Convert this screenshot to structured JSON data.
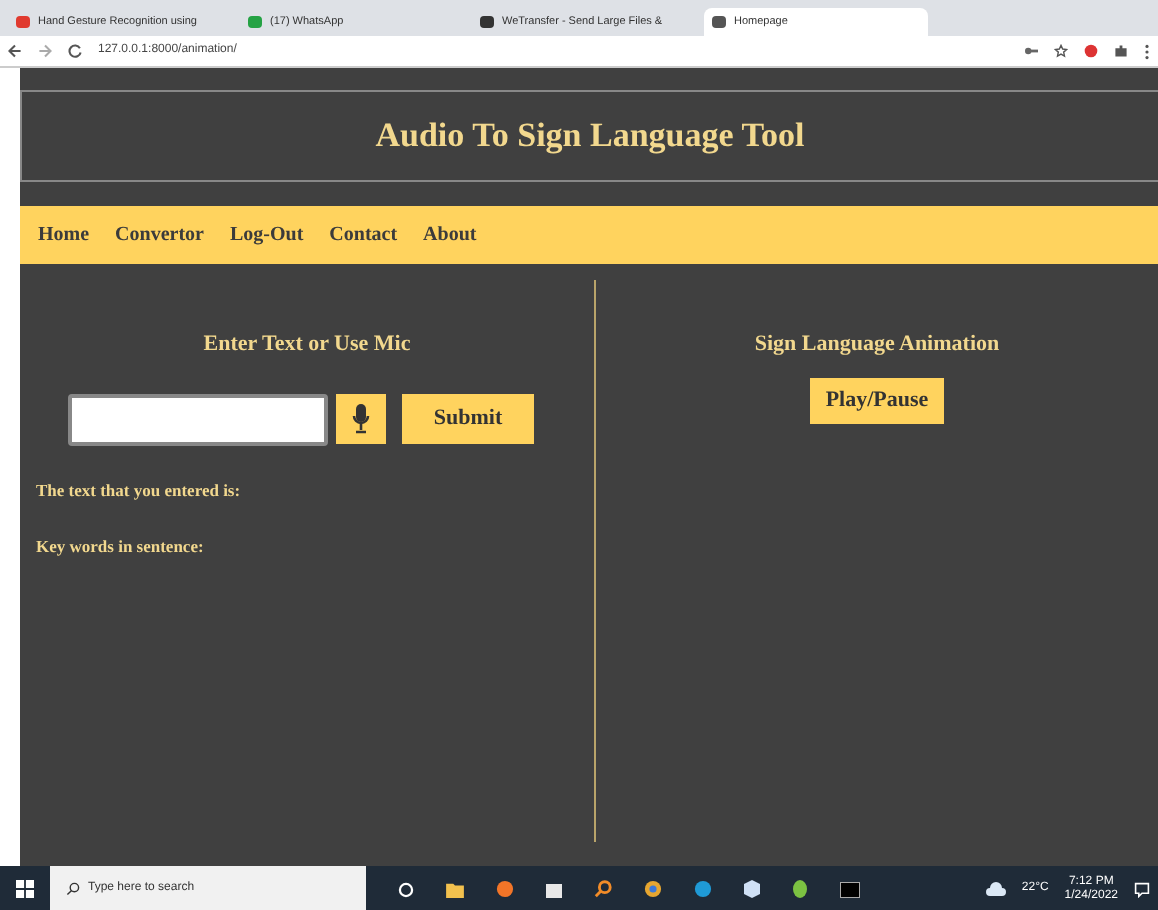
{
  "browser": {
    "tabs": [
      {
        "title": "Hand Gesture Recognition using",
        "color": "#e03a2f",
        "selected": false
      },
      {
        "title": "(17) WhatsApp",
        "color": "#25a244",
        "selected": false
      },
      {
        "title": "WeTransfer - Send Large Files &",
        "color": "#333333",
        "selected": false
      },
      {
        "title": "Homepage",
        "color": "#555555",
        "selected": true
      }
    ],
    "url": "127.0.0.1:8000/animation/"
  },
  "page": {
    "title": "Audio To Sign Language Tool",
    "nav": [
      "Home",
      "Convertor",
      "Log-Out",
      "Contact",
      "About"
    ],
    "left": {
      "heading": "Enter Text or Use Mic",
      "submit": "Submit",
      "lines": [
        "The text that you entered is:",
        "Key words in sentence:"
      ]
    },
    "right": {
      "heading": "Sign Language Animation",
      "button": "Play/Pause"
    }
  },
  "taskbar": {
    "search_placeholder": "Type here to search",
    "temperature": "22°C",
    "time": "7:12 PM",
    "date": "1/24/2022"
  }
}
